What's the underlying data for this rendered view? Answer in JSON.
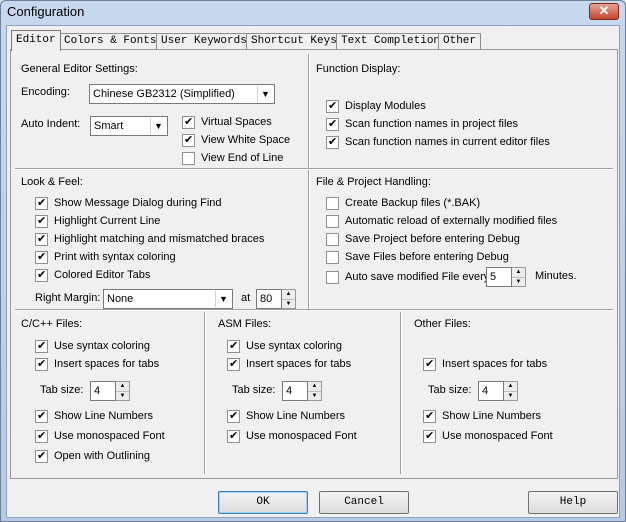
{
  "window": {
    "title": "Configuration",
    "close_icon": "close-icon"
  },
  "tabs": [
    "Editor",
    "Colors & Fonts",
    "User Keywords",
    "Shortcut Keys",
    "Text Completion",
    "Other"
  ],
  "general": {
    "heading": "General Editor Settings:",
    "encoding_label": "Encoding:",
    "encoding_value": "Chinese GB2312 (Simplified)",
    "auto_indent_label": "Auto Indent:",
    "auto_indent_value": "Smart",
    "virtual_spaces": "Virtual Spaces",
    "view_white_space": "View White Space",
    "view_end_of_line": "View End of Line"
  },
  "function_display": {
    "heading": "Function Display:",
    "display_modules": "Display Modules",
    "scan_project": "Scan function names in project files",
    "scan_editor": "Scan function names in current editor files"
  },
  "look_feel": {
    "heading": "Look & Feel:",
    "items": [
      "Show Message Dialog during Find",
      "Highlight Current Line",
      "Highlight matching and mismatched braces",
      "Print with syntax coloring",
      "Colored Editor Tabs"
    ],
    "right_margin_label": "Right Margin:",
    "right_margin_value": "None",
    "at_label": "at",
    "at_value": "80"
  },
  "file_project": {
    "heading": "File & Project Handling:",
    "items": [
      "Create Backup files (*.BAK)",
      "Automatic reload of externally modified files",
      "Save Project before entering Debug",
      "Save Files before entering Debug",
      "Auto save modified File every"
    ],
    "minutes_value": "5",
    "minutes_label": "Minutes."
  },
  "cpp": {
    "heading": "C/C++ Files:",
    "use_syntax_coloring": "Use syntax coloring",
    "insert_spaces": "Insert spaces for tabs",
    "tab_size_label": "Tab size:",
    "tab_size_value": "4",
    "show_line_numbers": "Show Line Numbers",
    "use_mono_font": "Use monospaced Font",
    "open_with_outlining": "Open with Outlining"
  },
  "asm": {
    "heading": "ASM Files:",
    "use_syntax_coloring": "Use syntax coloring",
    "insert_spaces": "Insert spaces for tabs",
    "tab_size_label": "Tab size:",
    "tab_size_value": "4",
    "show_line_numbers": "Show Line Numbers",
    "use_mono_font": "Use monospaced Font"
  },
  "other": {
    "heading": "Other Files:",
    "insert_spaces": "Insert spaces for tabs",
    "tab_size_label": "Tab size:",
    "tab_size_value": "4",
    "show_line_numbers": "Show Line Numbers",
    "use_mono_font": "Use monospaced Font"
  },
  "buttons": {
    "ok": "OK",
    "cancel": "Cancel",
    "help": "Help"
  }
}
